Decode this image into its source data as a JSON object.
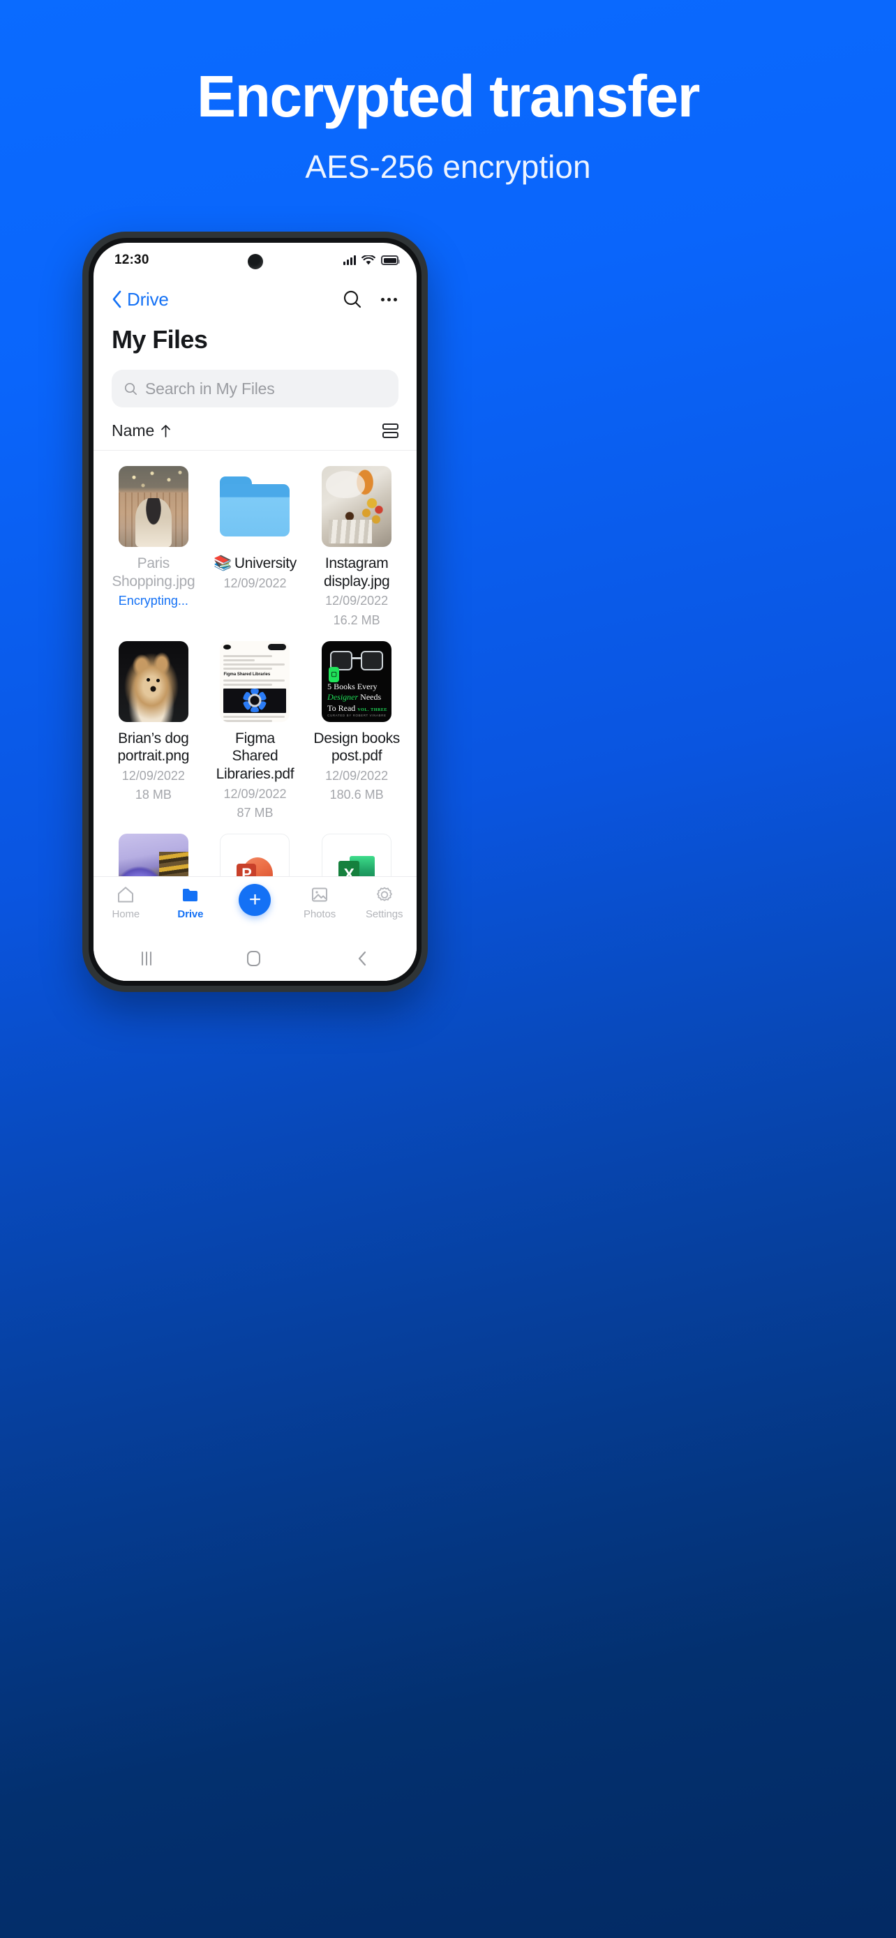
{
  "promo": {
    "title": "Encrypted transfer",
    "subtitle": "AES-256 encryption",
    "bg_top": "#0a6bff",
    "bg_bottom": "#032a63"
  },
  "phone": {
    "status_bar": {
      "time": "12:30",
      "signal_icon": "cellular-signal-icon",
      "wifi_icon": "wifi-icon",
      "battery_icon": "battery-icon"
    },
    "nav_bar": {
      "back_label": "Drive",
      "back_icon": "chevron-left-icon",
      "search_icon": "search-icon",
      "more_icon": "more-options-icon"
    },
    "page_title": "My Files",
    "search": {
      "placeholder": "Search in My Files",
      "value": "",
      "icon": "search-icon"
    },
    "sort": {
      "label": "Name",
      "direction_icon": "arrow-up-icon",
      "view_toggle_icon": "list-view-icon"
    },
    "accent_color": "#1471f5",
    "files": [
      {
        "name": "Paris Shopping.jpg",
        "date": "",
        "size": "",
        "status": "Encrypting...",
        "kind": "image",
        "muted": true
      },
      {
        "name": "University",
        "date": "12/09/2022",
        "size": "",
        "status": "",
        "kind": "folder",
        "emoji": "📚",
        "muted": false
      },
      {
        "name": "Instagram display.jpg",
        "date": "12/09/2022",
        "size": "16.2 MB",
        "status": "",
        "kind": "image",
        "muted": false
      },
      {
        "name": "Brian’s dog portrait.png",
        "date": "12/09/2022",
        "size": "18 MB",
        "status": "",
        "kind": "image",
        "muted": false
      },
      {
        "name": "Figma Shared Libraries.pdf",
        "date": "12/09/2022",
        "size": "87 MB",
        "status": "",
        "kind": "pdf",
        "muted": false
      },
      {
        "name": "Design books post.pdf",
        "date": "12/09/2022",
        "size": "180.6 MB",
        "status": "",
        "kind": "pdf",
        "muted": false
      }
    ],
    "figma_thumb": {
      "title": "Figma Shared Libraries"
    },
    "books_thumb": {
      "line1": "5 Books Every",
      "line2_em": "Designer",
      "line2_rest": " Needs",
      "line3": "To Read",
      "volume": "VOL. THREE",
      "credit": "CURATED BY ROBERT VINABRE"
    },
    "office_thumbs": {
      "powerpoint_letter": "P",
      "excel_letter": "X"
    },
    "bottom_nav": [
      {
        "label": "Home",
        "icon": "home-icon",
        "active": false
      },
      {
        "label": "Drive",
        "icon": "folder-icon",
        "active": true
      },
      {
        "label": "",
        "icon": "plus-icon",
        "active": false
      },
      {
        "label": "Photos",
        "icon": "photo-icon",
        "active": false
      },
      {
        "label": "Settings",
        "icon": "gear-icon",
        "active": false
      }
    ],
    "system_nav": {
      "recents_icon": "recents-icon",
      "home_icon": "home-pill-icon",
      "back_icon": "back-chevron-icon"
    }
  }
}
